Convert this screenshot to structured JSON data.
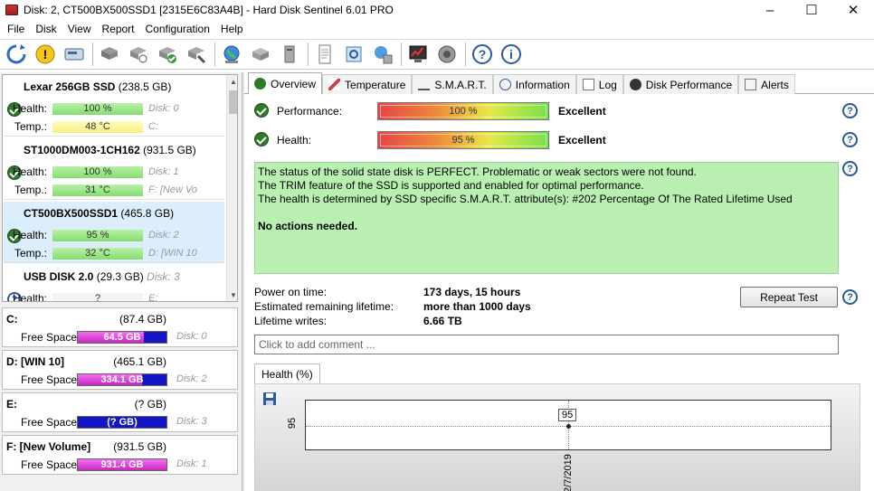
{
  "window": {
    "title": "Disk: 2, CT500BX500SSD1 [2315E6C83A4B]  -  Hard Disk Sentinel 6.01 PRO",
    "minimize": "–",
    "maximize": "☐",
    "close": "✕"
  },
  "menu": [
    "File",
    "Disk",
    "View",
    "Report",
    "Configuration",
    "Help"
  ],
  "toolbar_icons": [
    "refresh-icon",
    "alert-icon",
    "disk-icon",
    "hdd-gray-icon",
    "hdd-settings-icon",
    "hdd-check-icon",
    "hdd-tools-icon",
    "globe-icon",
    "network-icon",
    "server-icon",
    "report-icon",
    "sync-icon",
    "transfer-icon",
    "monitor-chart-icon",
    "sound-icon",
    "help-icon",
    "info-icon"
  ],
  "disks": [
    {
      "name": "Lexar 256GB SSD",
      "size": "(238.5 GB)",
      "health_label": "Health:",
      "health": "100 %",
      "health_pct": 100,
      "disk": "Disk: 0",
      "temp_label": "Temp.:",
      "temp": "48 °C",
      "drive": "C:",
      "status": "ok",
      "temp_color": "#f7ee82"
    },
    {
      "name": "ST1000DM003-1CH162",
      "size": "(931.5 GB)",
      "health_label": "Health:",
      "health": "100 %",
      "health_pct": 100,
      "disk": "Disk: 1",
      "temp_label": "Temp.:",
      "temp": "31 °C",
      "drive": "F: [New Vo",
      "status": "ok",
      "temp_color": "#86dc70"
    },
    {
      "name": "CT500BX500SSD1",
      "size": "(465.8 GB)",
      "health_label": "Health:",
      "health": "95 %",
      "health_pct": 95,
      "disk": "Disk: 2",
      "temp_label": "Temp.:",
      "temp": "32 °C",
      "drive": "D: [WIN 10",
      "status": "ok",
      "temp_color": "#86dc70"
    },
    {
      "name": "USB DISK 2.0",
      "size": "(29.3 GB)",
      "disk_inline": "Disk: 3",
      "health_label": "Health:",
      "health": "?",
      "drive": "E:",
      "status": "unknown"
    }
  ],
  "volumes": [
    {
      "name": "C:",
      "size": "(87.4 GB)",
      "free_label": "Free Space",
      "free": "64.5 GB",
      "free_pct": 74,
      "disk": "Disk: 0"
    },
    {
      "name": "D: [WIN 10]",
      "size": "(465.1 GB)",
      "free_label": "Free Space",
      "free": "334.1 GB",
      "free_pct": 72,
      "disk": "Disk: 2"
    },
    {
      "name": "E:",
      "size": "(? GB)",
      "free_label": "Free Space",
      "free": "(? GB)",
      "free_pct": 0,
      "disk": "Disk: 3"
    },
    {
      "name": "F: [New Volume]",
      "size": "(931.5 GB)",
      "free_label": "Free Space",
      "free": "931.4 GB",
      "free_pct": 100,
      "disk": "Disk: 1"
    }
  ],
  "tabs": [
    "Overview",
    "Temperature",
    "S.M.A.R.T.",
    "Information",
    "Log",
    "Disk Performance",
    "Alerts"
  ],
  "overview": {
    "performance_label": "Performance:",
    "performance_value": "100 %",
    "performance_verdict": "Excellent",
    "health_label": "Health:",
    "health_value": "95 %",
    "health_verdict": "Excellent",
    "status_lines": [
      "The status of the solid state disk is PERFECT. Problematic or weak sectors were not found.",
      "The TRIM feature of the SSD is supported and enabled for optimal performance.",
      "The health is determined by SSD specific S.M.A.R.T. attribute(s):  #202 Percentage Of The Rated Lifetime Used"
    ],
    "actions": "No actions needed.",
    "power_on_label": "Power on time:",
    "power_on_value": "173 days, 15 hours",
    "lifetime_label": "Estimated remaining lifetime:",
    "lifetime_value": "more than 1000 days",
    "writes_label": "Lifetime writes:",
    "writes_value": "6.66 TB",
    "repeat_button": "Repeat Test",
    "comment_placeholder": "Click to add comment ..."
  },
  "health_chart_tab": "Health (%)",
  "chart_data": {
    "type": "line",
    "title": "",
    "xlabel": "",
    "ylabel": "",
    "x": [
      "2/7/2019"
    ],
    "series": [
      {
        "values": [
          95
        ]
      }
    ],
    "y_ticks": [
      "95"
    ],
    "point_labels": [
      "95"
    ],
    "grid": true
  }
}
